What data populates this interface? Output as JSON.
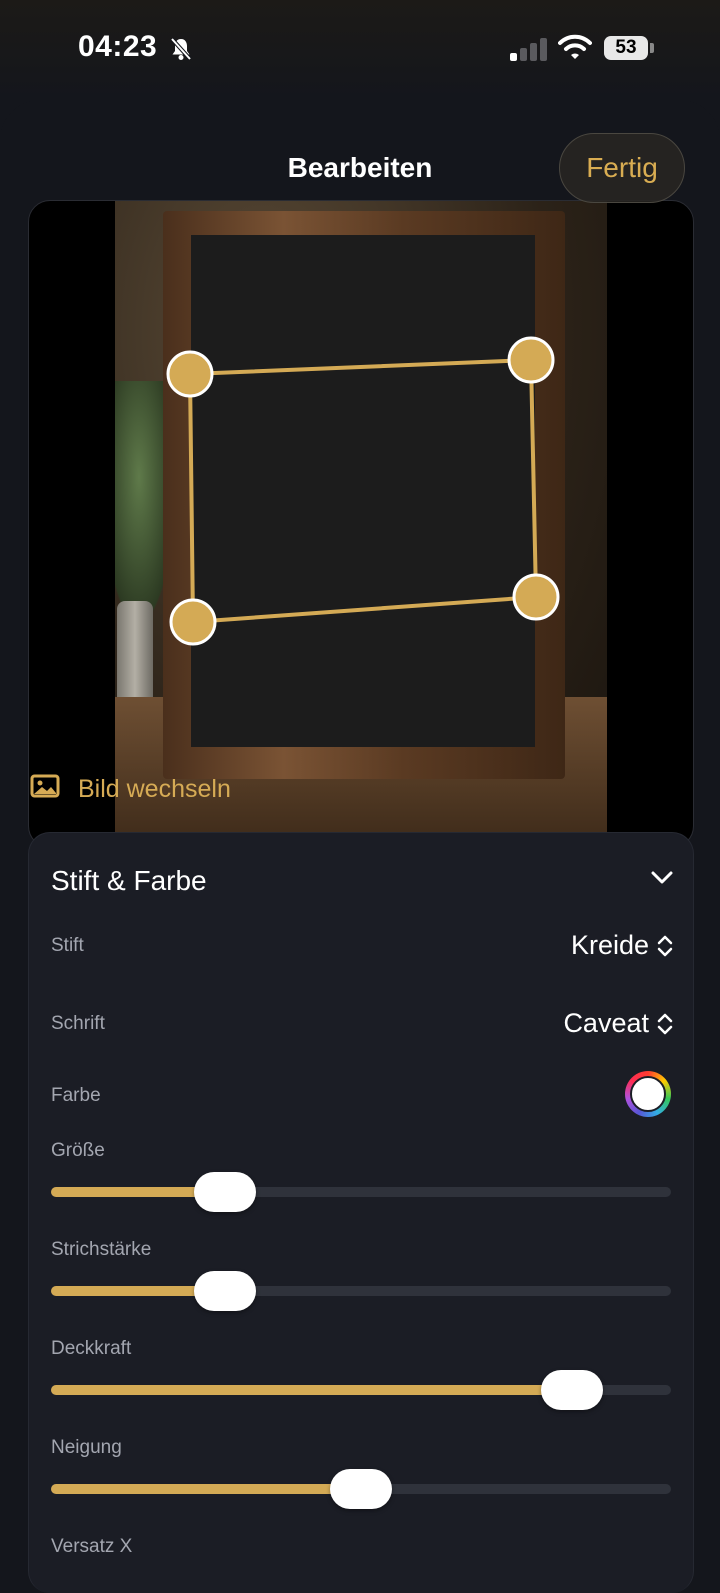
{
  "status_bar": {
    "time": "04:23",
    "battery": "53",
    "signal_bars_active": 1,
    "icons": [
      "bell-slash-icon",
      "signal-icon",
      "wifi-icon",
      "battery-icon"
    ]
  },
  "header": {
    "title": "Bearbeiten",
    "done_label": "Fertig",
    "accent": "#d6ab55"
  },
  "preview": {
    "handles": 4
  },
  "change_image": {
    "label": "Bild wechseln",
    "icon": "image-icon"
  },
  "settings": {
    "section_title": "Stift & Farbe",
    "pen": {
      "label": "Stift",
      "value": "Kreide"
    },
    "font": {
      "label": "Schrift",
      "value": "Caveat"
    },
    "color": {
      "label": "Farbe",
      "value": "#ffffff"
    },
    "sliders": [
      {
        "label": "Größe",
        "value": 0.28
      },
      {
        "label": "Strichstärke",
        "value": 0.28
      },
      {
        "label": "Deckkraft",
        "value": 0.84
      },
      {
        "label": "Neigung",
        "value": 0.5
      }
    ],
    "next_label": "Versatz X"
  }
}
